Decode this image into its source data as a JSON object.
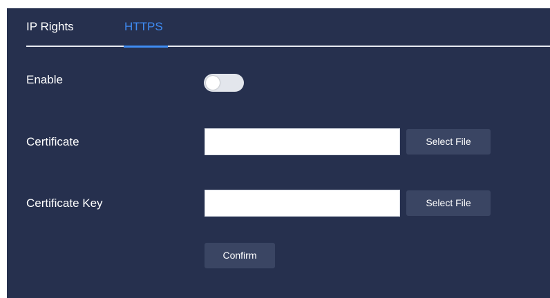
{
  "tabs": [
    {
      "label": "IP Rights",
      "active": false
    },
    {
      "label": "HTTPS",
      "active": true
    }
  ],
  "form": {
    "enable": {
      "label": "Enable",
      "on": false
    },
    "certificate": {
      "label": "Certificate",
      "value": "",
      "button": "Select File"
    },
    "certificate_key": {
      "label": "Certificate Key",
      "value": "",
      "button": "Select File"
    },
    "confirm_label": "Confirm"
  },
  "colors": {
    "panel_bg": "#26304e",
    "active_tab": "#3f8df5",
    "button_bg": "#3a4563",
    "toggle_off": "#e3e6ec"
  }
}
